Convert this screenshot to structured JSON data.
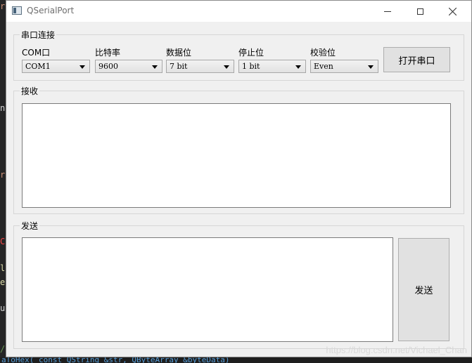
{
  "window": {
    "title": "QSerialPort",
    "app_icon": "window-app-icon",
    "controls": {
      "minimize": "minimize-icon",
      "maximize": "maximize-icon",
      "close": "close-icon"
    }
  },
  "connection": {
    "group_title": "串口连接",
    "fields": [
      {
        "label": "COM口",
        "value": "COM1"
      },
      {
        "label": "比特率",
        "value": "9600"
      },
      {
        "label": "数据位",
        "value": "7 bit"
      },
      {
        "label": "停止位",
        "value": "1 bit"
      },
      {
        "label": "校验位",
        "value": "Even"
      }
    ],
    "open_button": "打开串口"
  },
  "receive": {
    "group_title": "接收",
    "content": ""
  },
  "send": {
    "group_title": "发送",
    "content": "",
    "button": "发送"
  },
  "watermark": "https://blog.csdn.net/Vichael_Chan",
  "background": {
    "code_fragments": [
      "r*",
      "n)",
      "ri",
      "C",
      "l:",
      "e",
      "ut",
      "/"
    ],
    "bottom_line": "aToHex( const QString &str, QByteArray &byteData)"
  }
}
